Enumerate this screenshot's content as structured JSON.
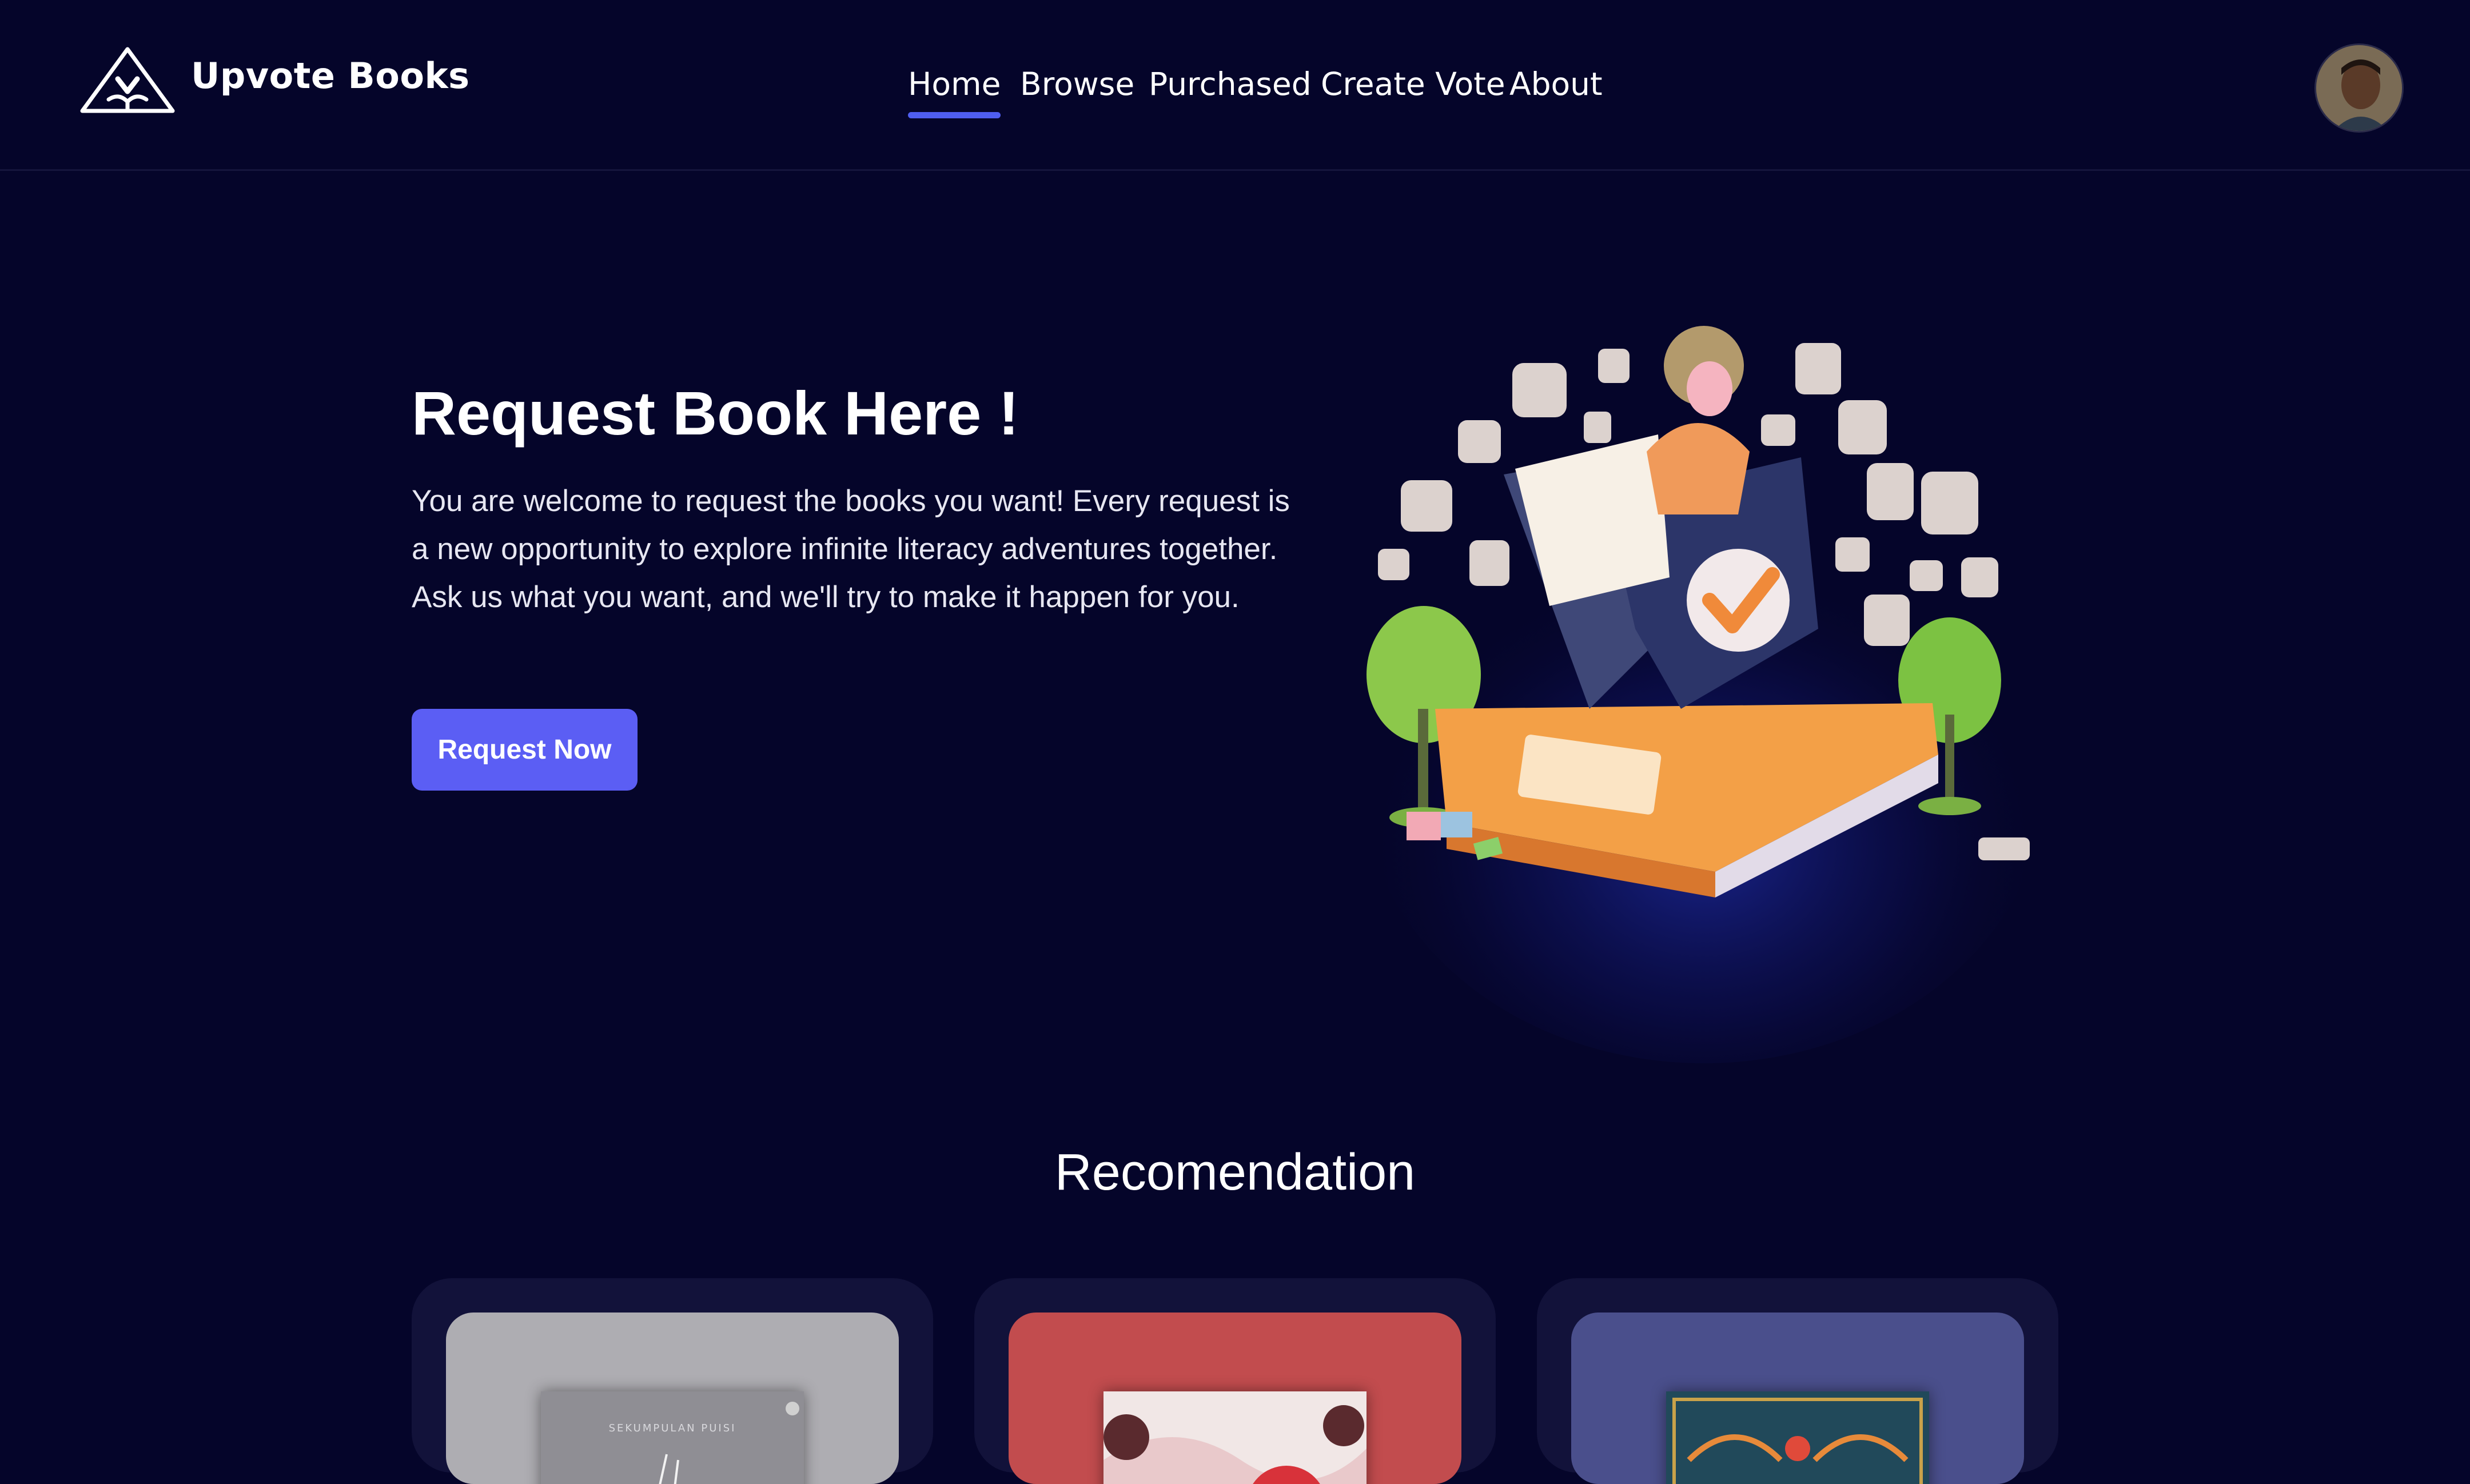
{
  "app": {
    "brand": "Upvote Books"
  },
  "nav": {
    "items": [
      {
        "label": "Home",
        "active": true
      },
      {
        "label": "Browse",
        "active": false
      },
      {
        "label": "Purchased",
        "active": false
      },
      {
        "label": "Create Vote",
        "active": false
      },
      {
        "label": "About",
        "active": false
      }
    ]
  },
  "hero": {
    "title": "Request Book Here !",
    "description": "You are welcome to request the books you want! Every request is a new opportunity to explore infinite literacy adventures together. Ask us what you want, and we'll try to make it happen for you.",
    "button_label": "Request Now"
  },
  "recommendation": {
    "title": "Recomendation",
    "cards": [
      {
        "cover_color": "#aeadb2",
        "book_color": "#8f8e94",
        "book_title": "SEKUMPULAN PUISI"
      },
      {
        "cover_color": "#c24c4e",
        "book_color": "#f1e7e6"
      },
      {
        "cover_color": "#4a4f8c",
        "book_color": "#21495a"
      }
    ]
  },
  "colors": {
    "background": "#05052a",
    "accent": "#5b5ef4",
    "nav_underline": "#4f5ef0"
  }
}
